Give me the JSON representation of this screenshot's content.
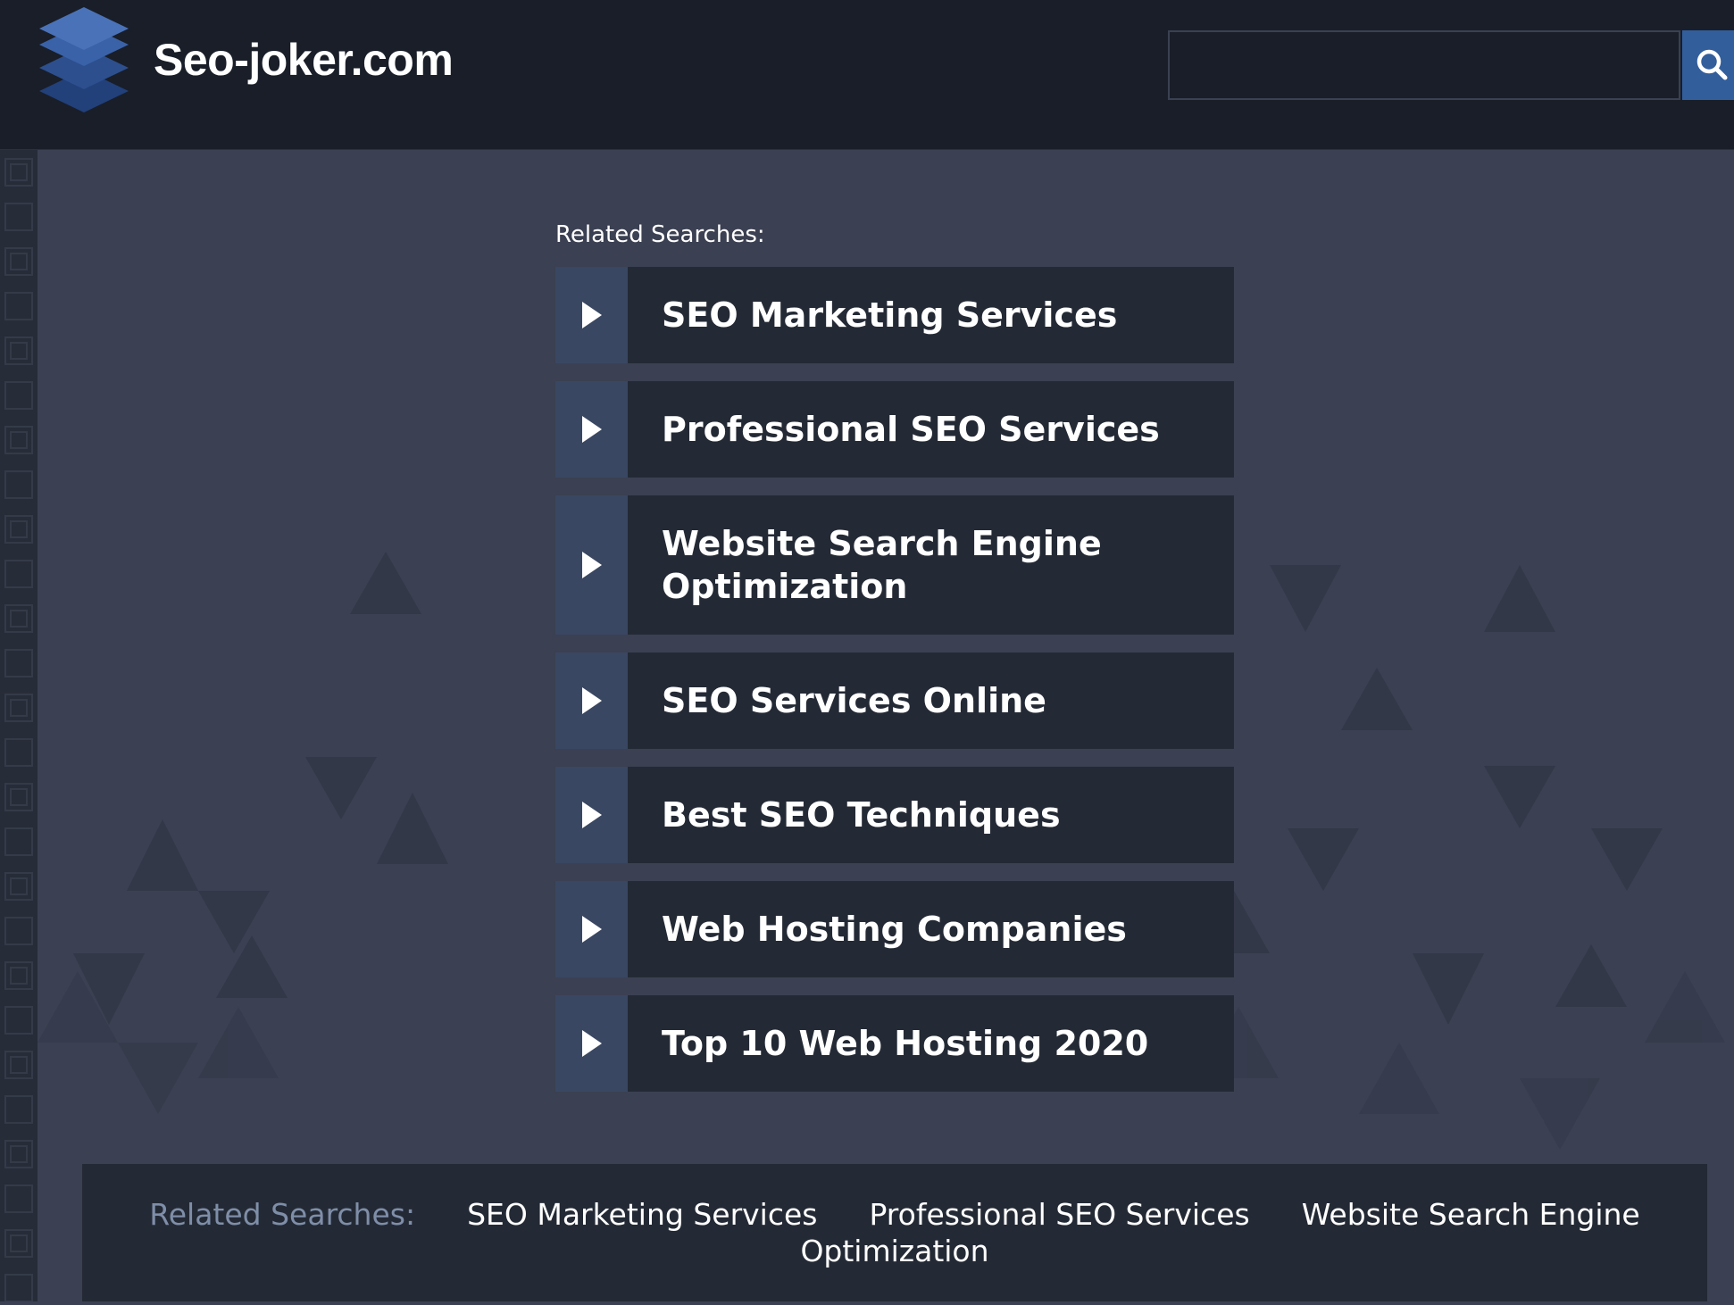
{
  "header": {
    "site_name": "Seo-joker.com",
    "search_placeholder": "",
    "search_value": ""
  },
  "main": {
    "related_label": "Related Searches:",
    "items": [
      {
        "label": "SEO Marketing Services"
      },
      {
        "label": "Professional SEO Services"
      },
      {
        "label": "Website Search Engine Optimization"
      },
      {
        "label": "SEO Services Online"
      },
      {
        "label": "Best SEO Techniques"
      },
      {
        "label": "Web Hosting Companies"
      },
      {
        "label": "Top 10 Web Hosting 2020"
      }
    ]
  },
  "footer": {
    "related_label": "Related Searches:",
    "links": [
      {
        "label": "SEO Marketing Services"
      },
      {
        "label": "Professional SEO Services"
      },
      {
        "label": "Website Search Engine Optimization"
      }
    ]
  },
  "colors": {
    "header_bg": "#191e28",
    "page_bg": "#3b4052",
    "item_bg": "#242a35",
    "arrow_bg": "#3a4762",
    "accent_blue": "#325e9c",
    "footer_label": "#7f8ea8"
  },
  "icons": {
    "logo": "stacked-layers-icon",
    "search": "search-icon",
    "item_arrow": "play-arrow-icon"
  }
}
